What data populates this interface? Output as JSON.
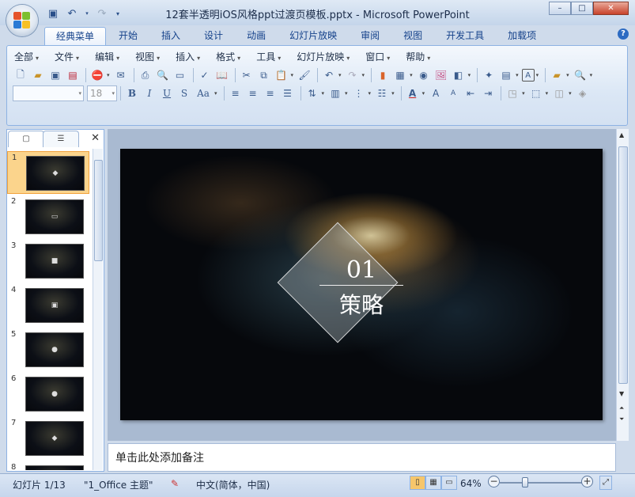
{
  "window": {
    "title": "12套半透明iOS风格ppt过渡页模板.pptx - Microsoft PowerPoint",
    "minimize": "–",
    "maximize": "□",
    "close": "✕"
  },
  "ribbon_tabs": [
    "经典菜单",
    "开始",
    "插入",
    "设计",
    "动画",
    "幻灯片放映",
    "审阅",
    "视图",
    "开发工具",
    "加载项"
  ],
  "active_tab": "经典菜单",
  "help": "?",
  "menus": [
    "全部",
    "文件",
    "编辑",
    "视图",
    "插入",
    "格式",
    "工具",
    "幻灯片放映",
    "窗口",
    "帮助"
  ],
  "font_box": {
    "font": "",
    "size": "18"
  },
  "format_buttons": {
    "bold": "B",
    "italic": "I",
    "underline": "U",
    "shadow": "S",
    "case": "Aa"
  },
  "slide_panel": {
    "slides": [
      {
        "num": "1",
        "mark": "◆"
      },
      {
        "num": "2",
        "mark": "▭"
      },
      {
        "num": "3",
        "mark": "■"
      },
      {
        "num": "4",
        "mark": "▣"
      },
      {
        "num": "5",
        "mark": "●"
      },
      {
        "num": "6",
        "mark": "●"
      },
      {
        "num": "7",
        "mark": "◆"
      },
      {
        "num": "8",
        "mark": ""
      }
    ],
    "selected": "1",
    "close": "✕"
  },
  "slide": {
    "number": "01",
    "title": "策略"
  },
  "notes_placeholder": "单击此处添加备注",
  "status": {
    "slide_info": "幻灯片 1/13",
    "theme": "\"1_Office 主题\"",
    "language": "中文(简体，中国)",
    "zoom": "64%",
    "zoom_level": 0.64
  },
  "colors": {
    "ribbon_bg": "#dbe7f5",
    "selected_thumb": "#fbd48c",
    "tab_text": "#15428b"
  }
}
